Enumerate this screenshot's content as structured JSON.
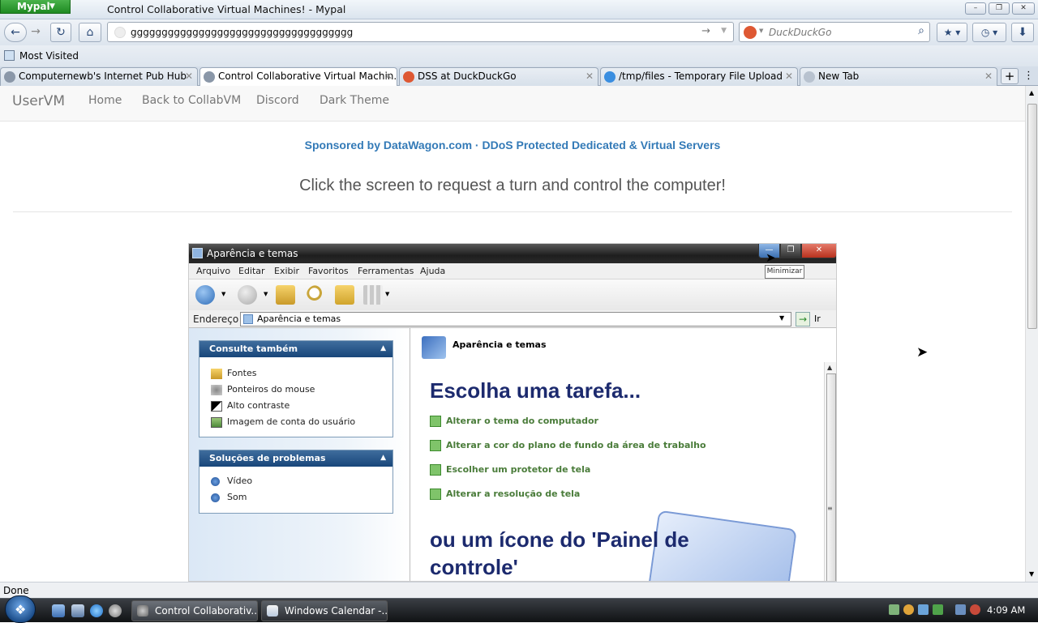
{
  "window": {
    "app_button": "Mypal",
    "title": "Control Collaborative Virtual Machines! - Mypal",
    "controls": {
      "minimize": "–",
      "restore": "❐",
      "close": "✕"
    }
  },
  "navbar": {
    "back": "←",
    "forward": "→",
    "reload": "↻",
    "home": "⌂",
    "url": "gggggggggggggggggggggggggggggggggggg",
    "go": "→",
    "dropdown": "▼",
    "search_placeholder": "DuckDuckGo",
    "search_icon": "⌕",
    "bookmark_btn": "★ ▾",
    "history_btn": "◷ ▾",
    "downloads_btn": "⬇"
  },
  "bookmarks": {
    "most_visited": "Most Visited"
  },
  "tabs": [
    {
      "label": "Computernewb's Internet Pub Hub",
      "close": "✕"
    },
    {
      "label": "Control Collaborative Virtual Machin...",
      "close": "✕"
    },
    {
      "label": "DSS at DuckDuckGo",
      "close": "✕"
    },
    {
      "label": "/tmp/files - Temporary File Upload",
      "close": "✕"
    },
    {
      "label": "New Tab",
      "close": "✕"
    }
  ],
  "tabbar": {
    "new_tab": "+",
    "list": "⋮"
  },
  "page": {
    "brand": "UserVM",
    "nav": [
      "Home",
      "Back to CollabVM",
      "Discord",
      "Dark Theme"
    ],
    "sponsor": "Sponsored by DataWagon.com · DDoS Protected Dedicated & Virtual Servers",
    "instruction": "Click the screen to request a turn and control the computer!"
  },
  "vm": {
    "title": "Aparência e temas",
    "controls": {
      "minimize": "—",
      "restore": "❐",
      "close": "✕"
    },
    "tooltip": "Minimizar",
    "menu": [
      "Arquivo",
      "Editar",
      "Exibir",
      "Favoritos",
      "Ferramentas",
      "Ajuda"
    ],
    "address_label": "Endereço",
    "address_value": "Aparência e temas",
    "address_dropdown": "▼",
    "go_arrow": "→",
    "go_label": "Ir",
    "panel_see_also": {
      "title": "Consulte também",
      "chevron": "▲",
      "items": [
        "Fontes",
        "Ponteiros do mouse",
        "Alto contraste",
        "Imagem de conta do usuário"
      ]
    },
    "panel_troubleshoot": {
      "title": "Soluções de problemas",
      "chevron": "▲",
      "items": [
        "Vídeo",
        "Som"
      ]
    },
    "breadcrumb": "Aparência e temas",
    "scroll_up": "▲",
    "scroll_grip": "≡",
    "heading_task": "Escolha uma tarefa...",
    "tasks": [
      "Alterar o tema do computador",
      "Alterar a cor do plano de fundo da área de trabalho",
      "Escolher um protetor de tela",
      "Alterar a resolução de tela"
    ],
    "heading_icon_1": "ou um ícone do 'Painel de",
    "heading_icon_2": "controle'"
  },
  "statusbar": {
    "text": "Done"
  },
  "taskbar": {
    "start_glyph": "❖",
    "buttons": [
      "Control Collaborativ...",
      "Windows Calendar -..."
    ],
    "clock": "4:09 AM"
  },
  "colors": {
    "accent_link": "#337ab7",
    "vm_heading": "#1c2a6e",
    "task_green": "#4a7c3a"
  }
}
